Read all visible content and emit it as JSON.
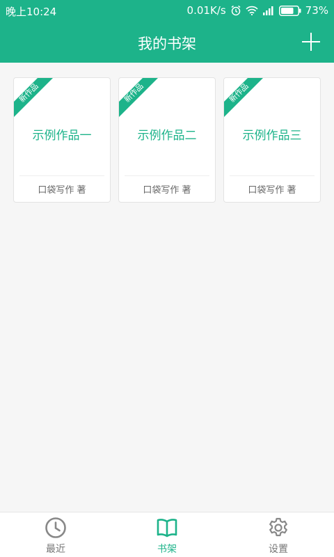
{
  "status_bar": {
    "time": "晚上10:24",
    "net_speed": "0.01K/s",
    "battery": "73%",
    "battery_level": 0.73
  },
  "header": {
    "title": "我的书架",
    "add_icon": "plus-icon"
  },
  "books": [
    {
      "badge": "新作品",
      "title": "示例作品一",
      "author": "口袋写作 著"
    },
    {
      "badge": "新作品",
      "title": "示例作品二",
      "author": "口袋写作 著"
    },
    {
      "badge": "新作品",
      "title": "示例作品三",
      "author": "口袋写作 著"
    }
  ],
  "bottom_nav": [
    {
      "label": "最近",
      "icon": "clock-icon",
      "active": false
    },
    {
      "label": "书架",
      "icon": "book-icon",
      "active": true
    },
    {
      "label": "设置",
      "icon": "gear-icon",
      "active": false
    }
  ],
  "colors": {
    "accent": "#1db38a",
    "background": "#f6f6f6",
    "inactive": "#888888"
  }
}
